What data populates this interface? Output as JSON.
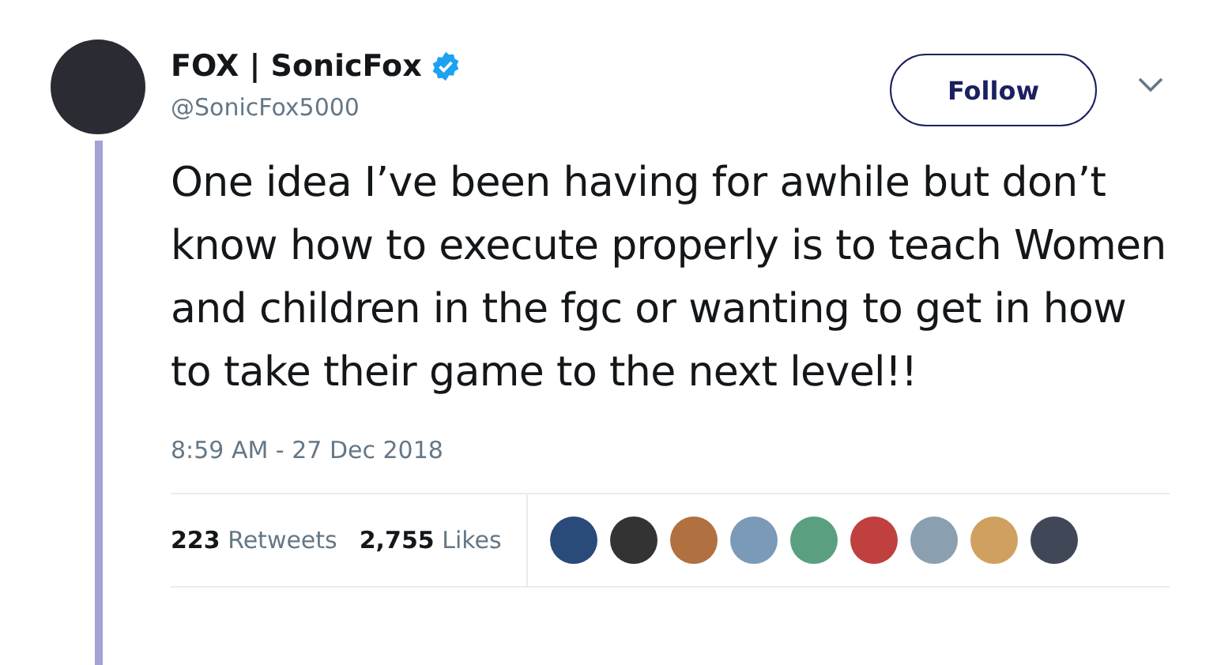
{
  "author": {
    "name": "FOX | SonicFox",
    "verified": true,
    "handle": "@SonicFox5000"
  },
  "follow_button": {
    "label": "Follow"
  },
  "text": "One idea I’ve been having for awhile but don’t know how to execute properly is to teach Women and children in the fgc or wanting to get in how to take their game to the next level!!",
  "timestamp": "8:59 AM - 27 Dec 2018",
  "stats": [
    {
      "count": "223",
      "label": "Retweets"
    },
    {
      "count": "2,755",
      "label": "Likes"
    }
  ]
}
